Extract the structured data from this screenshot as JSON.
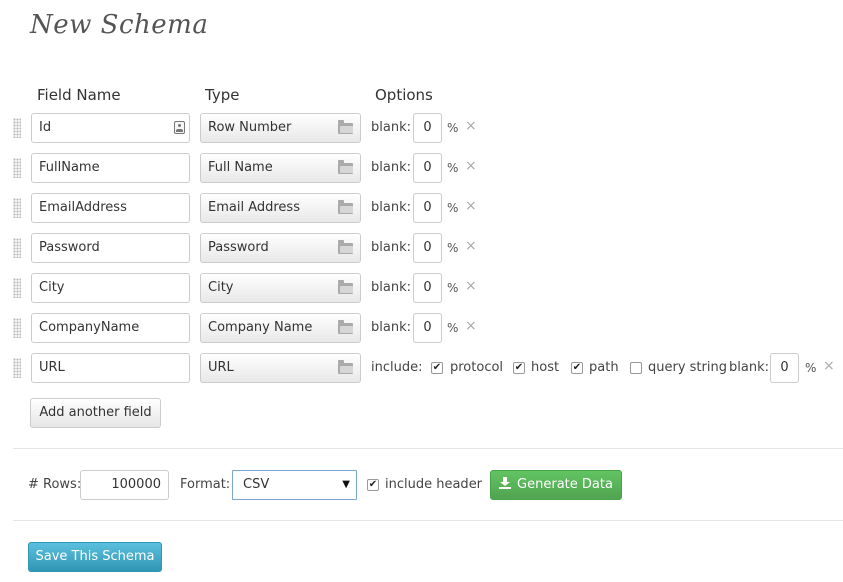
{
  "title": "New Schema",
  "columns": {
    "field_name": "Field Name",
    "type": "Type",
    "options": "Options"
  },
  "blank_label": "blank:",
  "percent": "%",
  "remove_glyph": "×",
  "rows": [
    {
      "name": "Id",
      "type": "Row Number",
      "blank": "0"
    },
    {
      "name": "FullName",
      "type": "Full Name",
      "blank": "0"
    },
    {
      "name": "EmailAddress",
      "type": "Email Address",
      "blank": "0"
    },
    {
      "name": "Password",
      "type": "Password",
      "blank": "0"
    },
    {
      "name": "City",
      "type": "City",
      "blank": "0"
    },
    {
      "name": "CompanyName",
      "type": "Company Name",
      "blank": "0"
    },
    {
      "name": "URL",
      "type": "URL",
      "blank": "0",
      "include_label": "include:",
      "options": [
        {
          "label": "protocol",
          "checked": true
        },
        {
          "label": "host",
          "checked": true
        },
        {
          "label": "path",
          "checked": true
        },
        {
          "label": "query string",
          "checked": false
        }
      ]
    }
  ],
  "add_field_label": "Add another field",
  "footer": {
    "rows_label": "# Rows:",
    "rows_value": "100000",
    "format_label": "Format:",
    "format_value": "CSV",
    "include_header_label": "include header",
    "include_header_checked": true,
    "generate_label": "Generate Data",
    "save_label": "Save This Schema"
  },
  "colors": {
    "green": "#5cb85c",
    "blue": "#49afcd"
  }
}
